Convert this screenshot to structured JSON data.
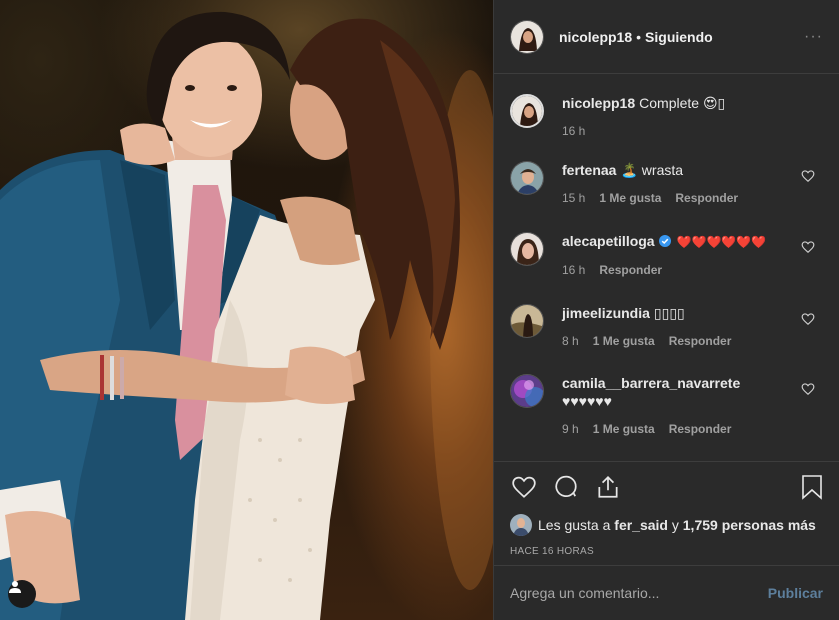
{
  "post": {
    "author": "nicolepp18",
    "separator": "•",
    "follow_status": "Siguiendo",
    "more_glyph": "···"
  },
  "caption": {
    "name": "nicolepp18",
    "text": "Complete 😍▯",
    "time": "16 h"
  },
  "comments": [
    {
      "name": "fertenaa",
      "text": "🏝️ wrasta",
      "time": "15 h",
      "likes": "1 Me gusta",
      "reply": "Responder"
    },
    {
      "name": "alecapetilloga",
      "text": "❤️❤️❤️❤️❤️❤️",
      "time": "16 h",
      "likes": "",
      "reply": "Responder"
    },
    {
      "name": "jimeelizundia",
      "text": "▯▯▯▯",
      "time": "8 h",
      "likes": "1 Me gusta",
      "reply": "Responder"
    },
    {
      "name": "camila__barrera_navarrete",
      "text": "♥♥♥♥♥♥",
      "time": "9 h",
      "likes": "1 Me gusta",
      "reply": "Responder"
    }
  ],
  "likes": {
    "prefix": "Les gusta a",
    "user": "fer_said",
    "middle": "y",
    "count": "1,759 personas más"
  },
  "timestamp": "HACE 16 HORAS",
  "comment_box": {
    "placeholder": "Agrega un comentario...",
    "publish": "Publicar"
  },
  "icons": {
    "like": "heart-outline-icon",
    "comment": "speech-bubble-icon",
    "share": "share-upload-icon",
    "save": "bookmark-icon",
    "tag": "person-icon"
  },
  "colors": {
    "panel_bg": "#2a2a2a",
    "heart_red": "#e0242f",
    "publish_disabled": "#5d7f9c",
    "verified_blue": "#3897f0"
  }
}
